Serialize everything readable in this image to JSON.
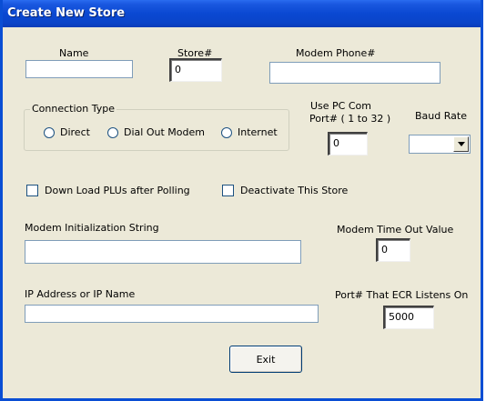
{
  "window": {
    "title": "Create New Store"
  },
  "fields": {
    "name": {
      "label": "Name",
      "value": ""
    },
    "store_num": {
      "label": "Store#",
      "value": "0"
    },
    "modem_phone": {
      "label": "Modem Phone#",
      "value": ""
    },
    "com_port": {
      "label_line1": "Use PC Com",
      "label_line2": "Port# ( 1  to 32 )",
      "value": "0"
    },
    "baud_rate": {
      "label": "Baud Rate",
      "value": ""
    },
    "modem_init": {
      "label": "Modem Initialization String",
      "value": ""
    },
    "modem_timeout": {
      "label": "Modem Time Out Value",
      "value": "0"
    },
    "ip_address": {
      "label": "IP Address or IP Name",
      "value": ""
    },
    "ecr_port": {
      "label": "Port# That ECR Listens On",
      "value": "5000"
    }
  },
  "connection_type": {
    "label": "Connection Type",
    "options": [
      "Direct",
      "Dial Out Modem",
      "Internet"
    ]
  },
  "checkboxes": {
    "download_plus": "Down Load PLUs after Polling",
    "deactivate": "Deactivate This Store"
  },
  "buttons": {
    "exit": "Exit"
  },
  "icons": {
    "combo_arrow": "chevron-down-icon"
  }
}
